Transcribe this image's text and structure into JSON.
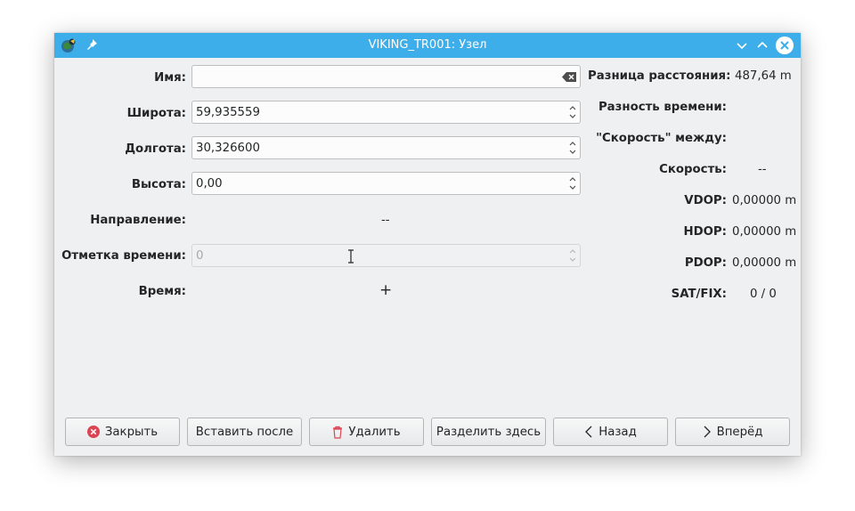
{
  "window": {
    "title": "VIKING_TR001: Узел"
  },
  "form": {
    "name_label": "Имя:",
    "name_value": "",
    "lat_label": "Широта:",
    "lat_value": "59,935559",
    "lon_label": "Долгота:",
    "lon_value": "30,326600",
    "alt_label": "Высота:",
    "alt_value": "0,00",
    "course_label": "Направление:",
    "course_value": "--",
    "timestamp_label": "Отметка времени:",
    "timestamp_value": "0",
    "time_label": "Время:",
    "time_value": "+"
  },
  "stats": {
    "dist_label": "Разница расстояния:",
    "dist_value": "487,64 m",
    "time_diff_label": "Разность времени:",
    "time_diff_value": "",
    "speed_between_label": "\"Скорость\" между:",
    "speed_between_value": "",
    "speed_label": "Скорость:",
    "speed_value": "--",
    "vdop_label": "VDOP:",
    "vdop_value": "0,00000 m",
    "hdop_label": "HDOP:",
    "hdop_value": "0,00000 m",
    "pdop_label": "PDOP:",
    "pdop_value": "0,00000 m",
    "satfix_label": "SAT/FIX:",
    "satfix_value": "0 / 0"
  },
  "buttons": {
    "close": "Закрыть",
    "insert_after": "Вставить после",
    "delete": "Удалить",
    "split_here": "Разделить здесь",
    "back": "Назад",
    "forward": "Вперёд"
  },
  "colors": {
    "titlebar": "#3daee9",
    "window_bg": "#eff0f1",
    "close_icon": "#da4453",
    "delete_icon": "#da4453"
  },
  "icons": {
    "app": "viking-app-icon",
    "pin": "pin-icon",
    "minimize": "chevron-down-icon",
    "maximize": "chevron-up-icon",
    "close": "close-icon",
    "clear": "clear-text-icon",
    "spin": "spin-arrows-icon",
    "close_button": "close-circle-icon",
    "delete_button": "trash-icon",
    "back_button": "chevron-left-icon",
    "forward_button": "chevron-right-icon",
    "cursor": "text-cursor-icon"
  }
}
